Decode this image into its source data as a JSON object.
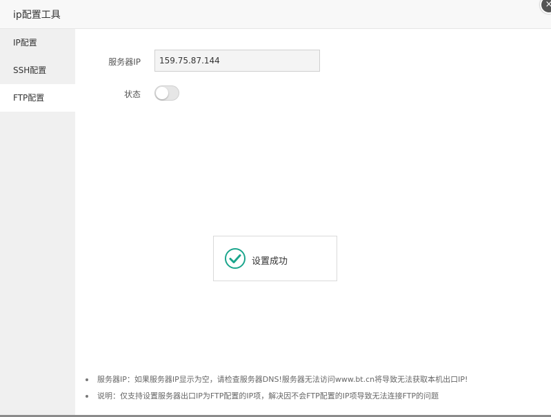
{
  "dialog": {
    "title": "ip配置工具",
    "close_glyph": "×"
  },
  "sidebar": {
    "items": [
      {
        "label": "IP配置"
      },
      {
        "label": "SSH配置"
      },
      {
        "label": "FTP配置",
        "active": true
      }
    ]
  },
  "form": {
    "server_ip_label": "服务器IP",
    "server_ip_value": "159.75.87.144",
    "status_label": "状态",
    "status_on": false
  },
  "toast": {
    "icon": "check-circle-icon",
    "message": "设置成功",
    "color": "#1aa58c"
  },
  "notes": [
    "服务器IP：如果服务器IP显示为空，请检查服务器DNS!服务器无法访问www.bt.cn将导致无法获取本机出口IP!",
    "说明：仅支持设置服务器出口IP为FTP配置的IP项，解决因不会FTP配置的IP项导致无法连接FTP的问题"
  ]
}
